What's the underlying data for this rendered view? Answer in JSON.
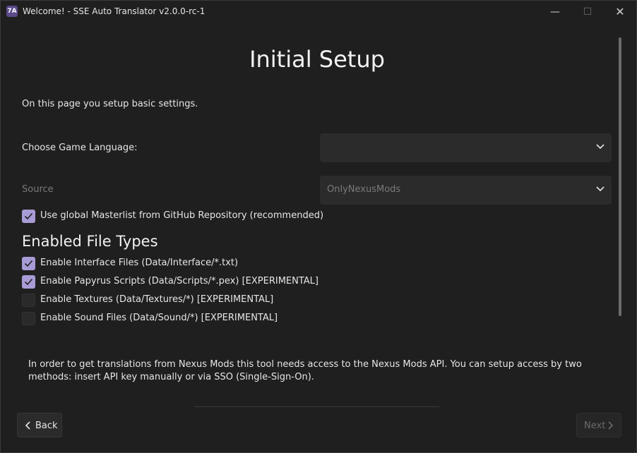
{
  "window": {
    "title": "Welcome! - SSE Auto Translator v2.0.0-rc-1",
    "app_icon_text": "7A",
    "minimize_glyph": "—",
    "maximize_glyph": "☐",
    "close_glyph": "✕"
  },
  "page": {
    "title": "Initial Setup",
    "intro": "On this page you setup basic settings."
  },
  "settings": {
    "language_label": "Choose Game Language:",
    "language_value": "",
    "source_label": "Source",
    "source_value": "OnlyNexusMods",
    "masterlist_label": "Use global Masterlist from GitHub Repository (recommended)",
    "masterlist_checked": true
  },
  "file_types": {
    "title": "Enabled File Types",
    "items": [
      {
        "label": "Enable Interface Files (Data/Interface/*.txt)",
        "checked": true
      },
      {
        "label": "Enable Papyrus Scripts (Data/Scripts/*.pex) [EXPERIMENTAL]",
        "checked": true
      },
      {
        "label": "Enable Textures (Data/Textures/*) [EXPERIMENTAL]",
        "checked": false
      },
      {
        "label": "Enable Sound Files (Data/Sound/*) [EXPERIMENTAL]",
        "checked": false
      }
    ]
  },
  "nexus": {
    "text": "In order to get translations from Nexus Mods this tool needs access to the Nexus Mods API. You can setup access by two methods: insert API key manually or via SSO (Single-Sign-On)."
  },
  "nav": {
    "back_label": "Back",
    "next_label": "Next"
  },
  "colors": {
    "accent": "#a99bd6",
    "background": "#1f1f1f",
    "combo_bg": "#2b2b2b"
  }
}
